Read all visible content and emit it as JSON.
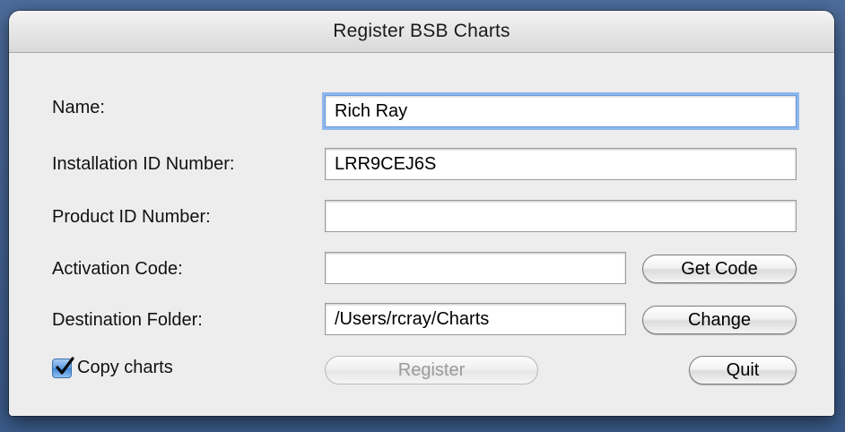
{
  "window": {
    "title": "Register BSB Charts"
  },
  "form": {
    "name_label": "Name:",
    "name_value": "Rich Ray",
    "installation_id_label": "Installation ID Number:",
    "installation_id_value": "LRR9CEJ6S",
    "product_id_label": "Product ID Number:",
    "product_id_value": "",
    "activation_code_label": "Activation Code:",
    "activation_code_value": "",
    "destination_folder_label": "Destination Folder:",
    "destination_folder_value": "/Users/rcray/Charts"
  },
  "buttons": {
    "get_code": "Get Code",
    "change": "Change",
    "register": "Register",
    "quit": "Quit"
  },
  "copy_charts": {
    "label": "Copy charts",
    "checked": true
  },
  "colors": {
    "accent": "#5d9be0",
    "focus_ring": "#8db8ec"
  }
}
